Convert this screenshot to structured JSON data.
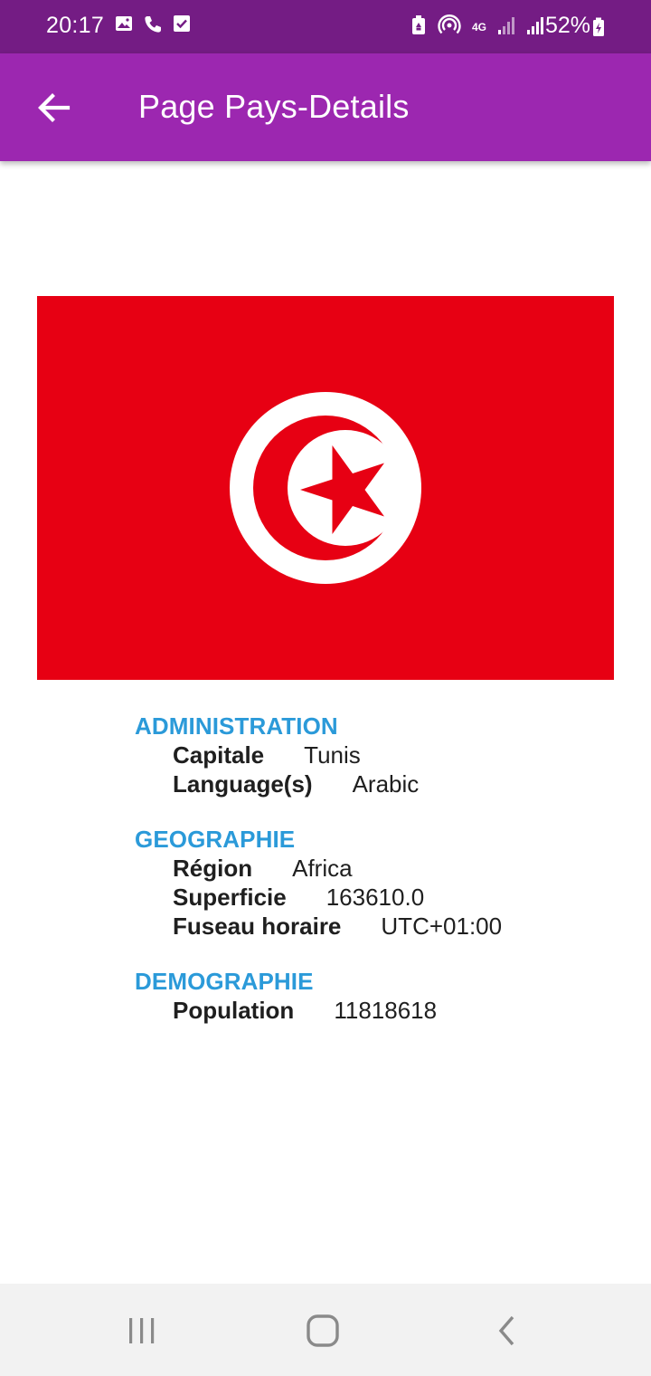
{
  "status_bar": {
    "time": "20:17",
    "battery": "52%",
    "network": "4G",
    "icons_left": [
      "image-icon",
      "phone-icon",
      "checkbox-icon"
    ],
    "icons_right": [
      "battery-saver-icon",
      "hotspot-icon",
      "signal-icon",
      "signal-icon",
      "battery-icon"
    ]
  },
  "app_bar": {
    "title": "Page Pays-Details",
    "background": "#9c27b0",
    "back_icon": "arrow-back-icon"
  },
  "flag": {
    "country": "Tunisia",
    "colors": {
      "red": "#e70013",
      "white": "#ffffff"
    }
  },
  "sections": [
    {
      "title": "ADMINISTRATION",
      "rows": [
        {
          "label": "Capitale",
          "value": "Tunis"
        },
        {
          "label": "Language(s)",
          "value": "Arabic"
        }
      ]
    },
    {
      "title": "GEOGRAPHIE",
      "rows": [
        {
          "label": "Région",
          "value": "Africa"
        },
        {
          "label": "Superficie",
          "value": "163610.0"
        },
        {
          "label": "Fuseau horaire",
          "value": "UTC+01:00"
        }
      ]
    },
    {
      "title": "DEMOGRAPHIE",
      "rows": [
        {
          "label": "Population",
          "value": "11818618"
        }
      ]
    }
  ],
  "nav_bar": {
    "buttons": [
      "recents-icon",
      "home-icon",
      "back-icon"
    ]
  },
  "colors": {
    "status_bar": "#741c84",
    "section_title": "#2b9ad9",
    "text": "#1f1f1f"
  }
}
